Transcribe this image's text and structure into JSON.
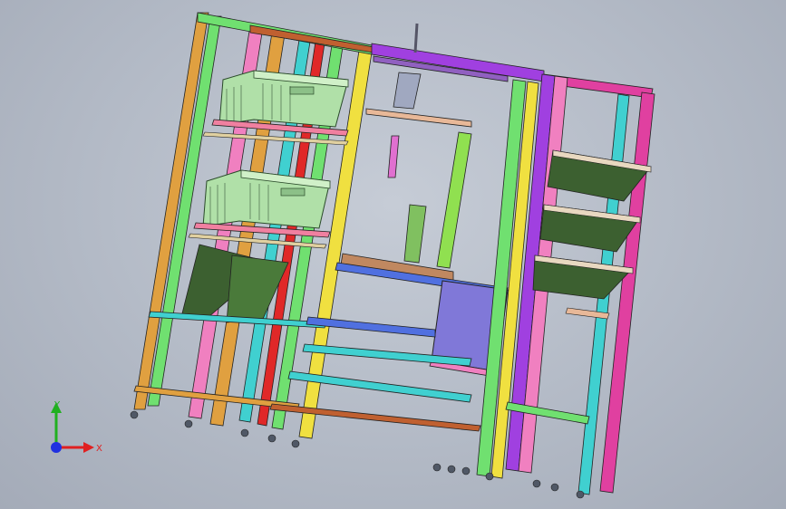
{
  "viewport": {
    "background": "#b8bfca",
    "triad": {
      "x_label": "X",
      "y_label": "Y",
      "x_color": "#e02020",
      "y_color": "#20b020",
      "z_color": "#2030e0"
    }
  },
  "model": {
    "frame_colors": [
      "#e0a040",
      "#70e070",
      "#f080c0",
      "#40d0d0",
      "#a040e0",
      "#e040a0",
      "#c06030",
      "#60c0ff"
    ],
    "crate_color": "#b0e0a8",
    "shelf_color": "#5a5030",
    "panel_color": "#8078d8",
    "tray_color": "#3c6030"
  }
}
